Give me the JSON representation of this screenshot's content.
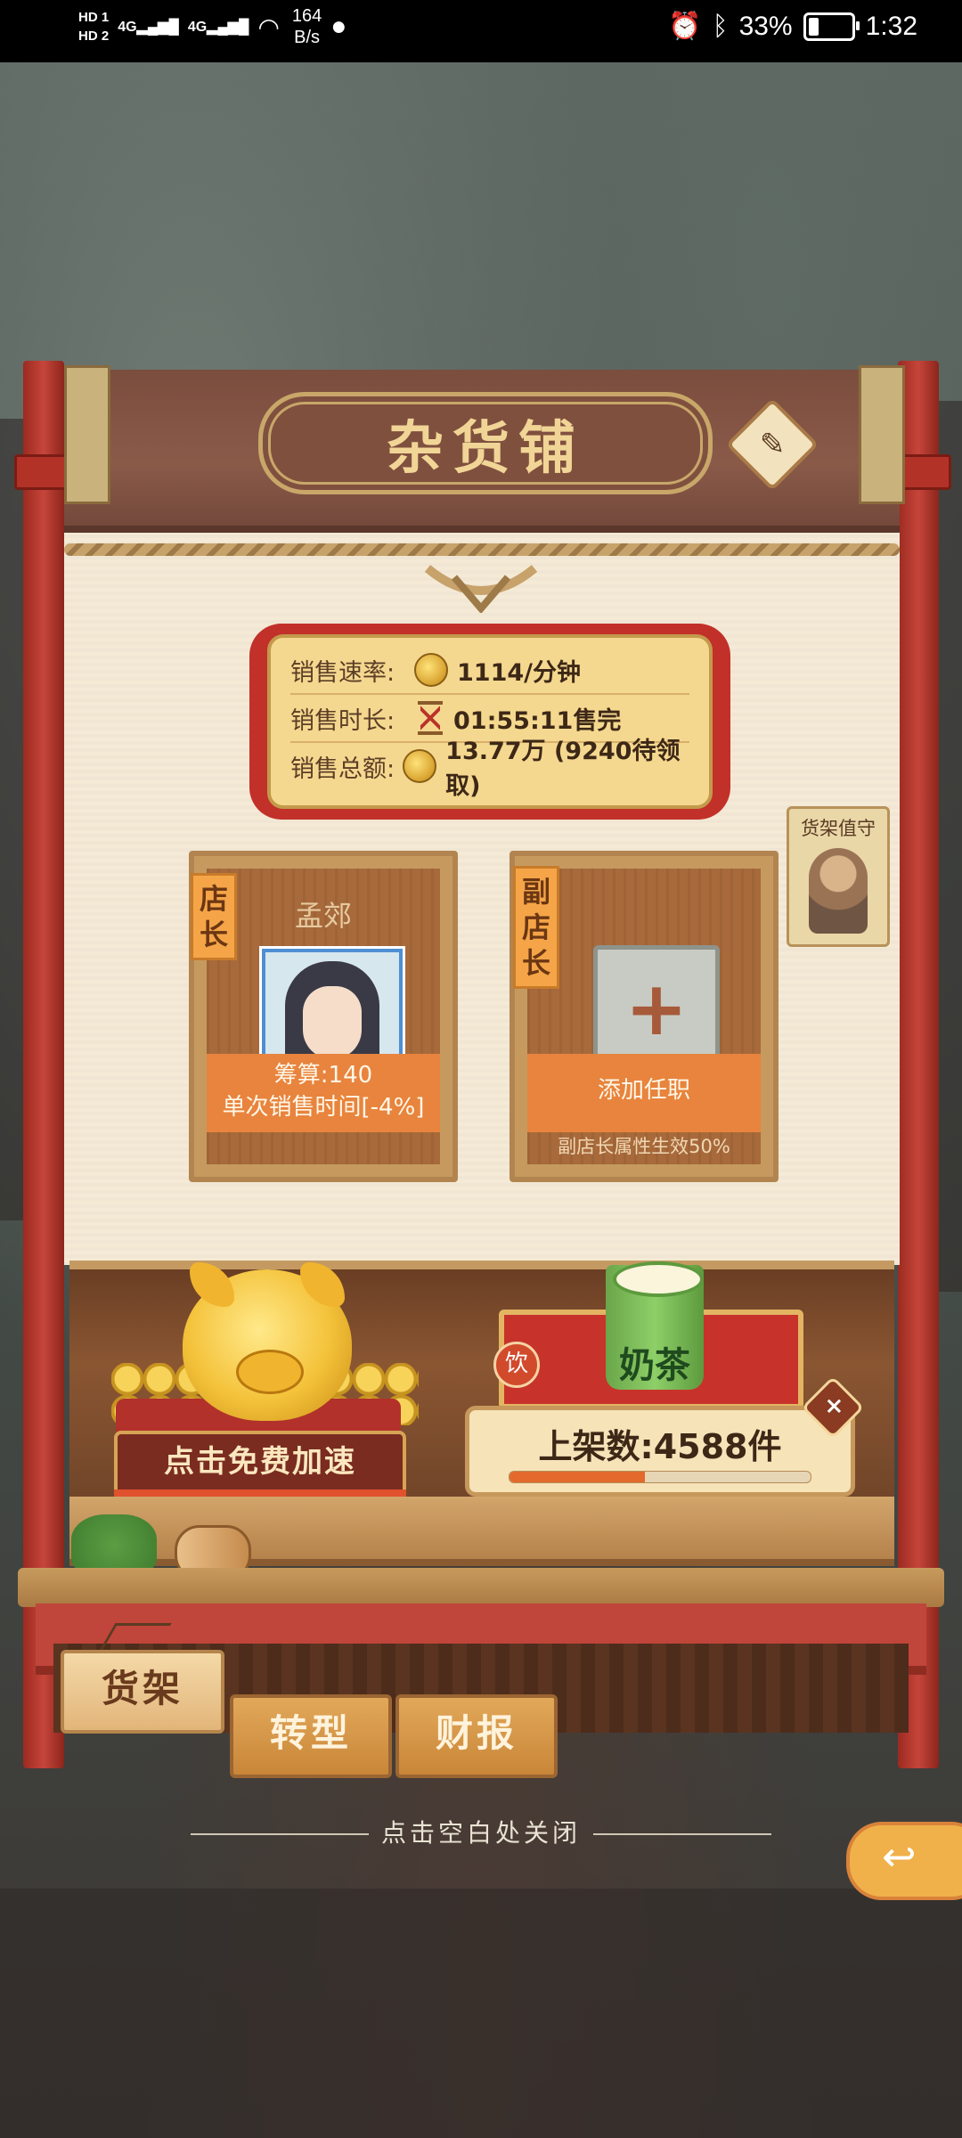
{
  "status_bar": {
    "hd1": "HD 1",
    "hd2": "HD 2",
    "sig1": "4G",
    "sig2": "4G",
    "net_speed": "164",
    "net_unit": "B/s",
    "battery": "33%",
    "battery_level": 0.33,
    "time": "1:32"
  },
  "shop": {
    "title": "杂货铺"
  },
  "sales": {
    "rate_label": "销售速率:",
    "rate_value": "1114/分钟",
    "duration_label": "销售时长:",
    "duration_value": "01:55:11售完",
    "total_label": "销售总额:",
    "total_value": "13.77万 (9240待领取)"
  },
  "guard": {
    "label": "货架值守"
  },
  "manager": {
    "tag": "店长",
    "name": "孟郊",
    "stat": "筹算:140",
    "effect": "单次销售时间[-4%]"
  },
  "deputy": {
    "tag": "副店长",
    "action": "添加任职",
    "plus": "+",
    "note": "副店长属性生效50%"
  },
  "speedup": {
    "label": "点击免费加速"
  },
  "goods": {
    "badge": "饮",
    "name": "奶茶",
    "stock": "上架数:4588件",
    "stock_fraction": 0.45,
    "close": "×"
  },
  "tabs": {
    "shelf": "货架",
    "transform": "转型",
    "report": "财报"
  },
  "hint": "点击空白处关闭",
  "colors": {
    "frame_red": "#c6453a",
    "paper": "#f4ead6",
    "gold": "#f1d596",
    "orange": "#e8843d"
  }
}
